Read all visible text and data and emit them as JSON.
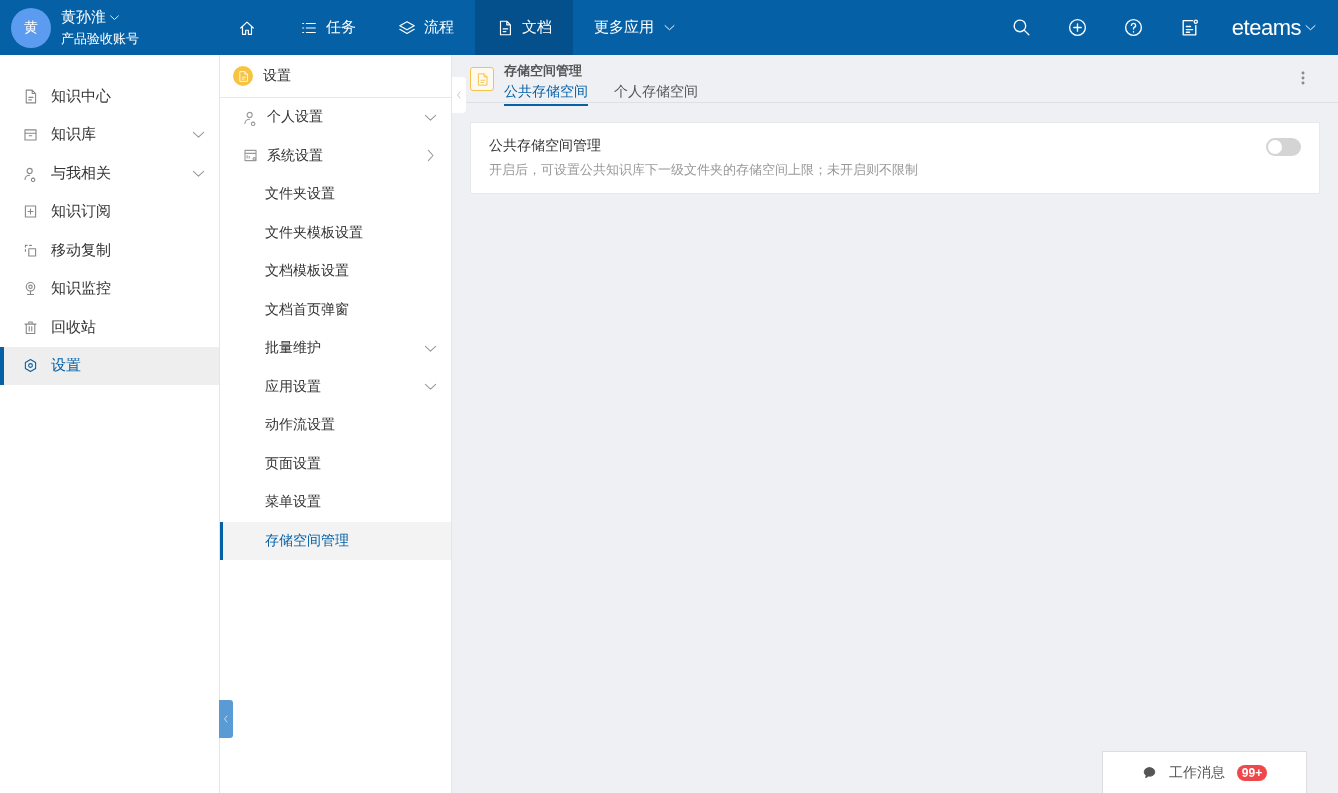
{
  "user": {
    "avatar": "黄",
    "name": "黄孙淮",
    "account": "产品验收账号"
  },
  "nav": [
    {
      "kind": "home",
      "selected": false
    },
    {
      "kind": "list",
      "label": "任务",
      "selected": false
    },
    {
      "kind": "layers",
      "label": "流程",
      "selected": false
    },
    {
      "kind": "doc",
      "label": "文档",
      "selected": true
    },
    {
      "kind": "more",
      "label": "更多应用",
      "selected": false
    }
  ],
  "toolbar": [
    {
      "kind": "search"
    },
    {
      "kind": "add"
    },
    {
      "kind": "help"
    },
    {
      "kind": "notes"
    }
  ],
  "brand": "eteams",
  "sidebar": {
    "items": [
      {
        "kind": "doc",
        "label": "知识中心",
        "expandable": false,
        "selected": false
      },
      {
        "kind": "box",
        "label": "知识库",
        "expandable": true,
        "selected": false
      },
      {
        "kind": "person",
        "label": "与我相关",
        "expandable": true,
        "selected": false
      },
      {
        "kind": "plus",
        "label": "知识订阅",
        "expandable": false,
        "selected": false
      },
      {
        "kind": "copy",
        "label": "移动复制",
        "expandable": false,
        "selected": false
      },
      {
        "kind": "camera",
        "label": "知识监控",
        "expandable": false,
        "selected": false
      },
      {
        "kind": "trash",
        "label": "回收站",
        "expandable": false,
        "selected": false
      },
      {
        "kind": "gear",
        "label": "设置",
        "expandable": false,
        "selected": true
      }
    ]
  },
  "settings_menu": {
    "title": "设置",
    "items": [
      {
        "kind": "person",
        "label": "个人设置",
        "expanded": false
      },
      {
        "kind": "panel",
        "label": "系统设置",
        "expanded": true,
        "children": [
          {
            "label": "文件夹设置",
            "selected": false
          },
          {
            "label": "文件夹模板设置",
            "selected": false
          },
          {
            "label": "文档模板设置",
            "selected": false
          },
          {
            "label": "文档首页弹窗",
            "selected": false
          },
          {
            "label": "批量维护",
            "expanded": false,
            "selected": false
          },
          {
            "label": "应用设置",
            "expanded": false,
            "selected": false
          },
          {
            "label": "动作流设置",
            "selected": false
          },
          {
            "label": "页面设置",
            "selected": false
          },
          {
            "label": "菜单设置",
            "selected": false
          },
          {
            "label": "存储空间管理",
            "selected": true
          }
        ]
      }
    ]
  },
  "page": {
    "title": "存储空间管理",
    "tabs": [
      {
        "label": "公共存储空间",
        "selected": true
      },
      {
        "label": "个人存储空间",
        "selected": false
      }
    ],
    "setting": {
      "title": "公共存储空间管理",
      "description": "开启后，可设置公共知识库下一级文件夹的存储空间上限；未开启则不限制",
      "on": false
    }
  },
  "messages": {
    "label": "工作消息",
    "badge": "99+"
  }
}
